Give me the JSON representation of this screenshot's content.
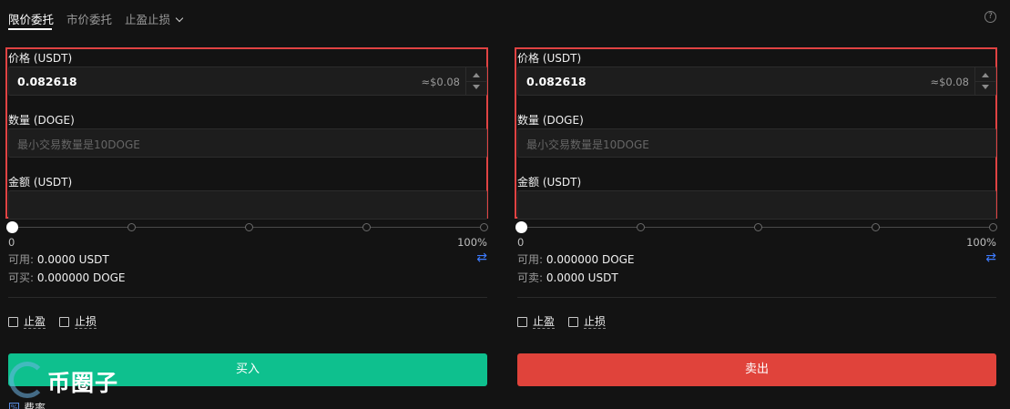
{
  "tabs": [
    {
      "label": "限价委托",
      "active": true
    },
    {
      "label": "市价委托",
      "active": false
    },
    {
      "label": "止盈止损",
      "active": false,
      "dropdown": true
    }
  ],
  "help_icon": "question-circle-icon",
  "buy_panel": {
    "price_label": "价格 (USDT)",
    "price_value": "0.082618",
    "price_approx": "≈$0.08",
    "amount_label": "数量 (DOGE)",
    "amount_placeholder": "最小交易数量是10DOGE",
    "total_label": "金额 (USDT)",
    "total_value": "",
    "slider_min": "0",
    "slider_max": "100%",
    "slider_value": 0,
    "available_label": "可用:",
    "available_value": "0.0000 USDT",
    "can_label": "可买:",
    "can_value": "0.000000 DOGE",
    "take_profit": "止盈",
    "stop_loss": "止损",
    "button": "买入",
    "button_color": "#0ec08e"
  },
  "sell_panel": {
    "price_label": "价格 (USDT)",
    "price_value": "0.082618",
    "price_approx": "≈$0.08",
    "amount_label": "数量 (DOGE)",
    "amount_placeholder": "最小交易数量是10DOGE",
    "total_label": "金额 (USDT)",
    "total_value": "",
    "slider_min": "0",
    "slider_max": "100%",
    "slider_value": 0,
    "available_label": "可用:",
    "available_value": "0.000000 DOGE",
    "can_label": "可卖:",
    "can_value": "0.0000 USDT",
    "take_profit": "止盈",
    "stop_loss": "止损",
    "button": "卖出",
    "button_color": "#e0433b"
  },
  "swap_icon": "swap-arrows-icon",
  "fee": {
    "label": "费率"
  },
  "watermark": {
    "text": "币圈子"
  },
  "highlight_color": "#e04343"
}
